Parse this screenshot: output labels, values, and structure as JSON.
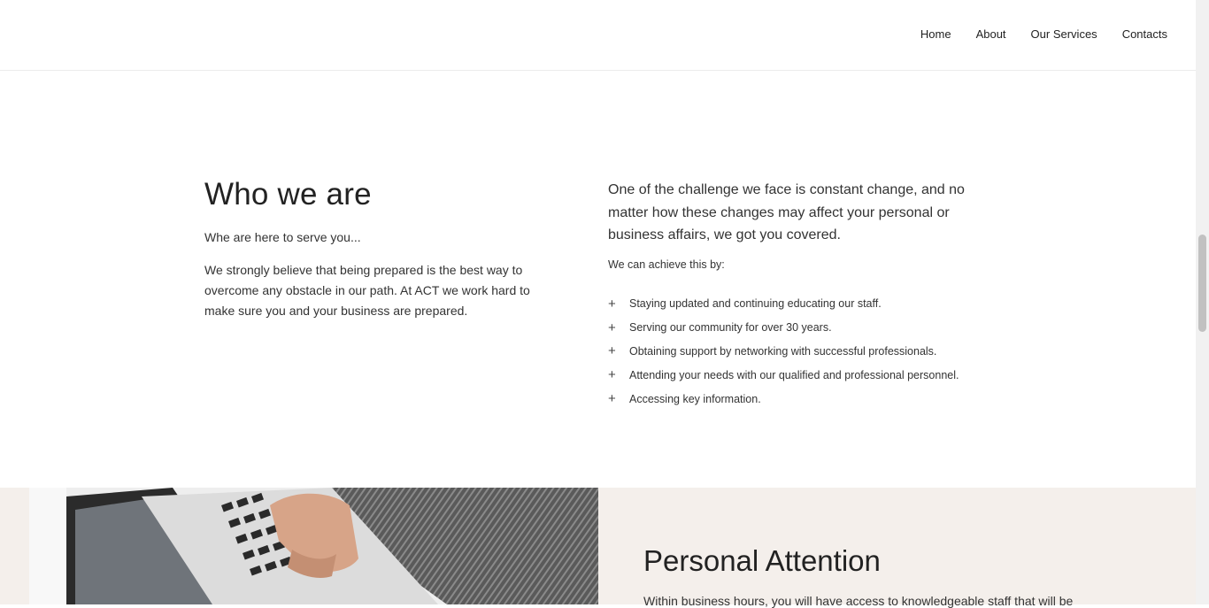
{
  "nav": {
    "items": [
      "Home",
      "About",
      "Our Services",
      "Contacts"
    ]
  },
  "who": {
    "title": "Who we are",
    "subtitle": "Whe are here to serve you...",
    "body": "We strongly believe that being prepared is the best way to overcome any obstacle in our path. At ACT we work hard to make sure you and your business are prepared."
  },
  "right": {
    "intro": "One of the challenge we face is constant change, and no matter how these changes may affect your personal or business affairs, we got you covered.",
    "lead": "We can achieve this by:",
    "items": [
      "Staying updated and continuing educating our staff.",
      "Serving our community for over 30 years.",
      "Obtaining support by networking with successful professionals.",
      "Attending your needs with our qualified and professional personnel.",
      "Accessing key information."
    ]
  },
  "attention": {
    "title": "Personal Attention",
    "text": "Within business hours, you will have access to knowledgeable staff that will be"
  },
  "icons": {
    "list_marker": "plus-icon",
    "photo": "laptop-photo"
  },
  "colors": {
    "band": "#f4efeb",
    "text": "#222222"
  }
}
